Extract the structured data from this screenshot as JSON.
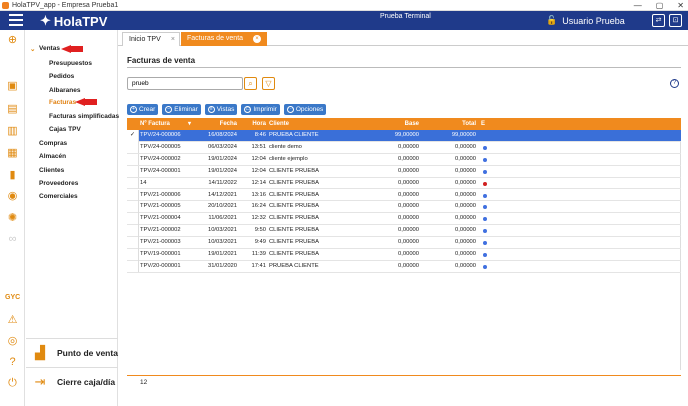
{
  "window": {
    "title": "HolaTPV_app - Empresa Prueba1",
    "min": "—",
    "max": "▢",
    "close": "✕"
  },
  "topbar": {
    "logo": "HolaTPV",
    "terminal": "Prueba Terminal",
    "user": "Usuario Prueba"
  },
  "nav": {
    "ventas": "Ventas",
    "presupuestos": "Presupuestos",
    "pedidos": "Pedidos",
    "albaranes": "Albaranes",
    "facturas": "Facturas",
    "facturas_simplificadas": "Facturas simplificadas",
    "cajas_tpv": "Cajas TPV",
    "compras": "Compras",
    "almacen": "Almacén",
    "clientes": "Clientes",
    "proveedores": "Proveedores",
    "comerciales": "Comerciales",
    "gyc": "GYC",
    "punto_venta": "Punto de venta",
    "cierre_caja": "Cierre caja/día"
  },
  "tabs": {
    "inicio": "Inicio TPV",
    "facturas": "Facturas de venta"
  },
  "page": {
    "title": "Facturas de venta",
    "search_value": "prueb"
  },
  "buttons": {
    "crear": "Crear",
    "eliminar": "Eliminar",
    "vistas": "Vistas",
    "imprimir": "Imprimir",
    "opciones": "Opciones"
  },
  "table": {
    "headers": {
      "num": "Nº Factura",
      "fecha": "Fecha",
      "hora": "Hora",
      "cliente": "Cliente",
      "base": "Base",
      "total": "Total",
      "e": "E"
    },
    "rows": [
      {
        "num": "TPV/24-000006",
        "fecha": "16/08/2024",
        "hora": "8:46",
        "cliente": "PRUEBA CLIENTE",
        "base": "99,00000",
        "total": "99,00000",
        "dot": "none"
      },
      {
        "num": "TPV/24-000005",
        "fecha": "06/03/2024",
        "hora": "13:51",
        "cliente": "cliente demo",
        "base": "0,00000",
        "total": "0,00000",
        "dot": "blue"
      },
      {
        "num": "TPV/24-000002",
        "fecha": "19/01/2024",
        "hora": "12:04",
        "cliente": "cliente ejemplo",
        "base": "0,00000",
        "total": "0,00000",
        "dot": "blue"
      },
      {
        "num": "TPV/24-000001",
        "fecha": "19/01/2024",
        "hora": "12:04",
        "cliente": "CLIENTE PRUEBA",
        "base": "0,00000",
        "total": "0,00000",
        "dot": "blue"
      },
      {
        "num": "14",
        "fecha": "14/11/2022",
        "hora": "12:14",
        "cliente": "CLIENTE PRUEBA",
        "base": "0,00000",
        "total": "0,00000",
        "dot": "red"
      },
      {
        "num": "TPV/21-000006",
        "fecha": "14/12/2021",
        "hora": "13:16",
        "cliente": "CLIENTE PRUEBA",
        "base": "0,00000",
        "total": "0,00000",
        "dot": "blue"
      },
      {
        "num": "TPV/21-000005",
        "fecha": "20/10/2021",
        "hora": "16:24",
        "cliente": "CLIENTE PRUEBA",
        "base": "0,00000",
        "total": "0,00000",
        "dot": "blue"
      },
      {
        "num": "TPV/21-000004",
        "fecha": "11/06/2021",
        "hora": "12:32",
        "cliente": "CLIENTE PRUEBA",
        "base": "0,00000",
        "total": "0,00000",
        "dot": "blue"
      },
      {
        "num": "TPV/21-000002",
        "fecha": "10/03/2021",
        "hora": "9:50",
        "cliente": "CLIENTE PRUEBA",
        "base": "0,00000",
        "total": "0,00000",
        "dot": "blue"
      },
      {
        "num": "TPV/21-000003",
        "fecha": "10/03/2021",
        "hora": "9:49",
        "cliente": "CLIENTE PRUEBA",
        "base": "0,00000",
        "total": "0,00000",
        "dot": "blue"
      },
      {
        "num": "TPV/19-000001",
        "fecha": "19/01/2021",
        "hora": "11:39",
        "cliente": "CLIENTE PRUEBA",
        "base": "0,00000",
        "total": "0,00000",
        "dot": "blue"
      },
      {
        "num": "TPV/20-000001",
        "fecha": "31/01/2020",
        "hora": "17:41",
        "cliente": "PRUEBA CLIENTE",
        "base": "0,00000",
        "total": "0,00000",
        "dot": "blue"
      }
    ],
    "count": "12"
  },
  "colors": {
    "accent": "#f08a1e",
    "primary": "#1f3a8a",
    "selection": "#3a6fd8"
  }
}
